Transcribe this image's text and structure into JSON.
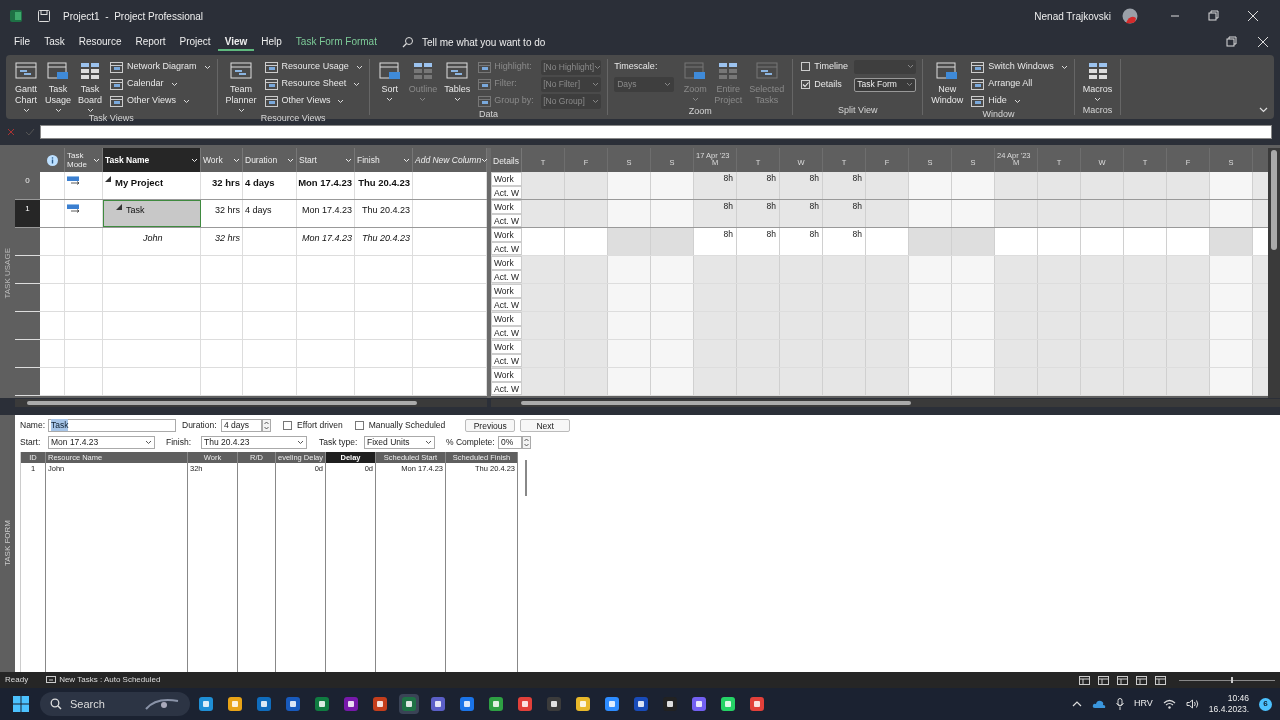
{
  "window": {
    "title": "Project1  -  Project Professional",
    "user": "Nenad Trajkovski"
  },
  "menu_tabs": [
    {
      "label": "File",
      "selected": false,
      "kind": "tab"
    },
    {
      "label": "Task",
      "selected": false,
      "kind": "tab"
    },
    {
      "label": "Resource",
      "selected": false,
      "kind": "tab"
    },
    {
      "label": "Report",
      "selected": false,
      "kind": "tab"
    },
    {
      "label": "Project",
      "selected": false,
      "kind": "tab"
    },
    {
      "label": "View",
      "selected": true,
      "kind": "tab"
    },
    {
      "label": "Help",
      "selected": false,
      "kind": "tab"
    },
    {
      "label": "Task Form Format",
      "selected": false,
      "kind": "contextual"
    }
  ],
  "tell_me": {
    "placeholder": "Tell me what you want to do"
  },
  "ribbon": [
    {
      "label": "Task Views",
      "items": [
        {
          "kind": "large",
          "lines": [
            "Gantt",
            "Chart"
          ],
          "dropdown": true,
          "disabled": false
        },
        {
          "kind": "large",
          "lines": [
            "Task",
            "Usage"
          ],
          "dropdown": true,
          "disabled": false
        },
        {
          "kind": "large",
          "lines": [
            "Task",
            "Board"
          ],
          "dropdown": true,
          "disabled": false
        },
        {
          "kind": "stack",
          "rows": [
            {
              "label": "Network Diagram",
              "dropdown": true
            },
            {
              "label": "Calendar",
              "dropdown": true
            },
            {
              "label": "Other Views",
              "dropdown": true
            }
          ]
        }
      ]
    },
    {
      "label": "Resource Views",
      "items": [
        {
          "kind": "large",
          "lines": [
            "Team",
            "Planner"
          ],
          "dropdown": true,
          "disabled": false
        },
        {
          "kind": "stack",
          "rows": [
            {
              "label": "Resource Usage",
              "dropdown": true
            },
            {
              "label": "Resource Sheet",
              "dropdown": true
            },
            {
              "label": "Other Views",
              "dropdown": true
            }
          ]
        }
      ]
    },
    {
      "label": "Data",
      "items": [
        {
          "kind": "large",
          "lines": [
            "Sort"
          ],
          "dropdown": true,
          "disabled": false
        },
        {
          "kind": "large",
          "lines": [
            "Outline"
          ],
          "dropdown": true,
          "disabled": true
        },
        {
          "kind": "large",
          "lines": [
            "Tables"
          ],
          "dropdown": true,
          "disabled": false
        },
        {
          "kind": "fields",
          "disabled": true,
          "rows": [
            {
              "label": "Highlight:",
              "value": "[No Highlight]"
            },
            {
              "label": "Filter:",
              "value": "[No Filter]"
            },
            {
              "label": "Group by:",
              "value": "[No Group]"
            }
          ]
        }
      ]
    },
    {
      "label": "Zoom",
      "items": [
        {
          "kind": "timescale",
          "label": "Timescale:",
          "value": "Days",
          "disabled": true
        },
        {
          "kind": "large",
          "lines": [
            "Zoom"
          ],
          "dropdown": true,
          "disabled": true
        },
        {
          "kind": "large",
          "lines": [
            "Entire",
            "Project"
          ],
          "dropdown": false,
          "disabled": true
        },
        {
          "kind": "large",
          "lines": [
            "Selected",
            "Tasks"
          ],
          "dropdown": false,
          "disabled": true
        }
      ]
    },
    {
      "label": "Split View",
      "items": [
        {
          "kind": "checks",
          "rows": [
            {
              "label": "Timeline",
              "checked": false
            },
            {
              "label": "Details",
              "checked": true,
              "value": "Task Form"
            }
          ]
        }
      ]
    },
    {
      "label": "Window",
      "items": [
        {
          "kind": "large",
          "lines": [
            "New",
            "Window"
          ],
          "dropdown": false,
          "disabled": false
        },
        {
          "kind": "stack",
          "rows": [
            {
              "label": "Switch Windows",
              "dropdown": true
            },
            {
              "label": "Arrange All",
              "dropdown": false
            },
            {
              "label": "Hide",
              "dropdown": true
            }
          ]
        }
      ]
    },
    {
      "label": "Macros",
      "items": [
        {
          "kind": "large",
          "lines": [
            "Macros"
          ],
          "dropdown": true,
          "disabled": false
        }
      ]
    }
  ],
  "side_labels": {
    "top": "TASK USAGE",
    "bottom": "TASK FORM"
  },
  "usage": {
    "columns": [
      {
        "kind": "info",
        "selected": false
      },
      {
        "kind": "text",
        "label": "Task Mode",
        "selected": false
      },
      {
        "kind": "text",
        "label": "Task Name",
        "selected": true
      },
      {
        "kind": "text",
        "label": "Work",
        "selected": false
      },
      {
        "kind": "text",
        "label": "Duration",
        "selected": false
      },
      {
        "kind": "text",
        "label": "Start",
        "selected": false
      },
      {
        "kind": "text",
        "label": "Finish",
        "selected": false
      },
      {
        "kind": "add",
        "label": "Add New Column",
        "selected": false
      }
    ],
    "details_header": "Details",
    "days": [
      {
        "label": "T",
        "nonworking": false
      },
      {
        "label": "F",
        "nonworking": false
      },
      {
        "label": "S",
        "nonworking": true
      },
      {
        "label": "S",
        "nonworking": true
      },
      {
        "label": "M",
        "nonworking": false,
        "week": "17 Apr '23"
      },
      {
        "label": "T",
        "nonworking": false
      },
      {
        "label": "W",
        "nonworking": false
      },
      {
        "label": "T",
        "nonworking": false
      },
      {
        "label": "F",
        "nonworking": false
      },
      {
        "label": "S",
        "nonworking": true
      },
      {
        "label": "S",
        "nonworking": true
      },
      {
        "label": "M",
        "nonworking": false,
        "week": "24 Apr '23"
      },
      {
        "label": "T",
        "nonworking": false
      },
      {
        "label": "W",
        "nonworking": false
      },
      {
        "label": "T",
        "nonworking": false
      },
      {
        "label": "F",
        "nonworking": false
      },
      {
        "label": "S",
        "nonworking": true
      }
    ],
    "rows": [
      {
        "kind": "summary",
        "id": "0",
        "selected": false,
        "expanded": true,
        "name": "My Project",
        "work": "32 hrs",
        "duration": "4 days",
        "start": "Mon 17.4.23",
        "finish": "Thu 20.4.23",
        "details": [
          "Work",
          "Act. W"
        ],
        "work_by_day": [
          {
            "kind": "blank"
          },
          {
            "kind": "blank"
          },
          {
            "kind": "blank"
          },
          {
            "kind": "blank"
          },
          {
            "kind": "value",
            "value": "8h"
          },
          {
            "kind": "value",
            "value": "8h"
          },
          {
            "kind": "value",
            "value": "8h"
          },
          {
            "kind": "value",
            "value": "8h"
          },
          {
            "kind": "blank"
          },
          {
            "kind": "blank"
          },
          {
            "kind": "blank"
          },
          {
            "kind": "blank"
          },
          {
            "kind": "blank"
          },
          {
            "kind": "blank"
          },
          {
            "kind": "blank"
          },
          {
            "kind": "blank"
          },
          {
            "kind": "blank"
          }
        ]
      },
      {
        "kind": "task",
        "id": "1",
        "selected": true,
        "expanded": true,
        "name": "Task",
        "work": "32 hrs",
        "duration": "4 days",
        "start": "Mon 17.4.23",
        "finish": "Thu 20.4.23",
        "details": [
          "Work",
          "Act. W"
        ],
        "work_by_day": [
          {
            "kind": "blank"
          },
          {
            "kind": "blank"
          },
          {
            "kind": "blank"
          },
          {
            "kind": "blank"
          },
          {
            "kind": "value",
            "value": "8h"
          },
          {
            "kind": "value",
            "value": "8h"
          },
          {
            "kind": "value",
            "value": "8h"
          },
          {
            "kind": "value",
            "value": "8h"
          },
          {
            "kind": "blank"
          },
          {
            "kind": "blank"
          },
          {
            "kind": "blank"
          },
          {
            "kind": "blank"
          },
          {
            "kind": "blank"
          },
          {
            "kind": "blank"
          },
          {
            "kind": "blank"
          },
          {
            "kind": "blank"
          },
          {
            "kind": "blank"
          }
        ]
      },
      {
        "kind": "assignment",
        "name": "John",
        "work": "32 hrs",
        "start": "Mon 17.4.23",
        "finish": "Thu 20.4.23",
        "details": [
          "Work",
          "Act. W"
        ],
        "work_by_day": [
          {
            "kind": "blank"
          },
          {
            "kind": "blank"
          },
          {
            "kind": "blank"
          },
          {
            "kind": "blank"
          },
          {
            "kind": "value",
            "value": "8h"
          },
          {
            "kind": "value",
            "value": "8h"
          },
          {
            "kind": "value",
            "value": "8h"
          },
          {
            "kind": "value",
            "value": "8h"
          },
          {
            "kind": "blank"
          },
          {
            "kind": "blank"
          },
          {
            "kind": "blank"
          },
          {
            "kind": "blank"
          },
          {
            "kind": "blank"
          },
          {
            "kind": "blank"
          },
          {
            "kind": "blank"
          },
          {
            "kind": "blank"
          },
          {
            "kind": "blank"
          }
        ]
      },
      {
        "kind": "empty",
        "details": [
          "Work",
          "Act. W"
        ]
      },
      {
        "kind": "empty",
        "details": [
          "Work",
          "Act. W"
        ]
      },
      {
        "kind": "empty",
        "details": [
          "Work",
          "Act. W"
        ]
      },
      {
        "kind": "empty",
        "details": [
          "Work",
          "Act. W"
        ]
      },
      {
        "kind": "empty",
        "details": [
          "Work",
          "Act. W"
        ]
      }
    ]
  },
  "form": {
    "name": {
      "label": "Name:",
      "value": "Task"
    },
    "duration": {
      "label": "Duration:",
      "value": "4 days"
    },
    "effort_driven": {
      "label": "Effort driven",
      "checked": false
    },
    "manually_scheduled": {
      "label": "Manually Scheduled",
      "checked": false
    },
    "buttons": [
      "Previous",
      "Next"
    ],
    "start": {
      "label": "Start:",
      "value": "Mon 17.4.23"
    },
    "finish": {
      "label": "Finish:",
      "value": "Thu 20.4.23"
    },
    "task_type": {
      "label": "Task type:",
      "value": "Fixed Units"
    },
    "percent_complete": {
      "label": "% Complete:",
      "value": "0%"
    },
    "columns": [
      {
        "label": "ID",
        "selected": false
      },
      {
        "label": "Resource Name",
        "selected": false
      },
      {
        "label": "Work",
        "selected": false
      },
      {
        "label": "R/D",
        "selected": false
      },
      {
        "label": "eveling Delay",
        "selected": false
      },
      {
        "label": "Delay",
        "selected": true
      },
      {
        "label": "Scheduled Start",
        "selected": false
      },
      {
        "label": "Scheduled Finish",
        "selected": false
      }
    ],
    "rows": [
      {
        "id": "1",
        "resource_name": "John",
        "work": "32h",
        "leveling_delay": "0d",
        "delay": "0d",
        "scheduled_start": "Mon 17.4.23",
        "scheduled_finish": "Thu 20.4.23"
      }
    ]
  },
  "status_bar": {
    "ready": "Ready",
    "new_tasks": "New Tasks : Auto Scheduled",
    "zoom": {
      "level": 0.55
    }
  },
  "taskbar": {
    "search": "Search",
    "language": "HRV",
    "time": "10:46",
    "date": "16.4.2023.",
    "notifications": "6"
  }
}
